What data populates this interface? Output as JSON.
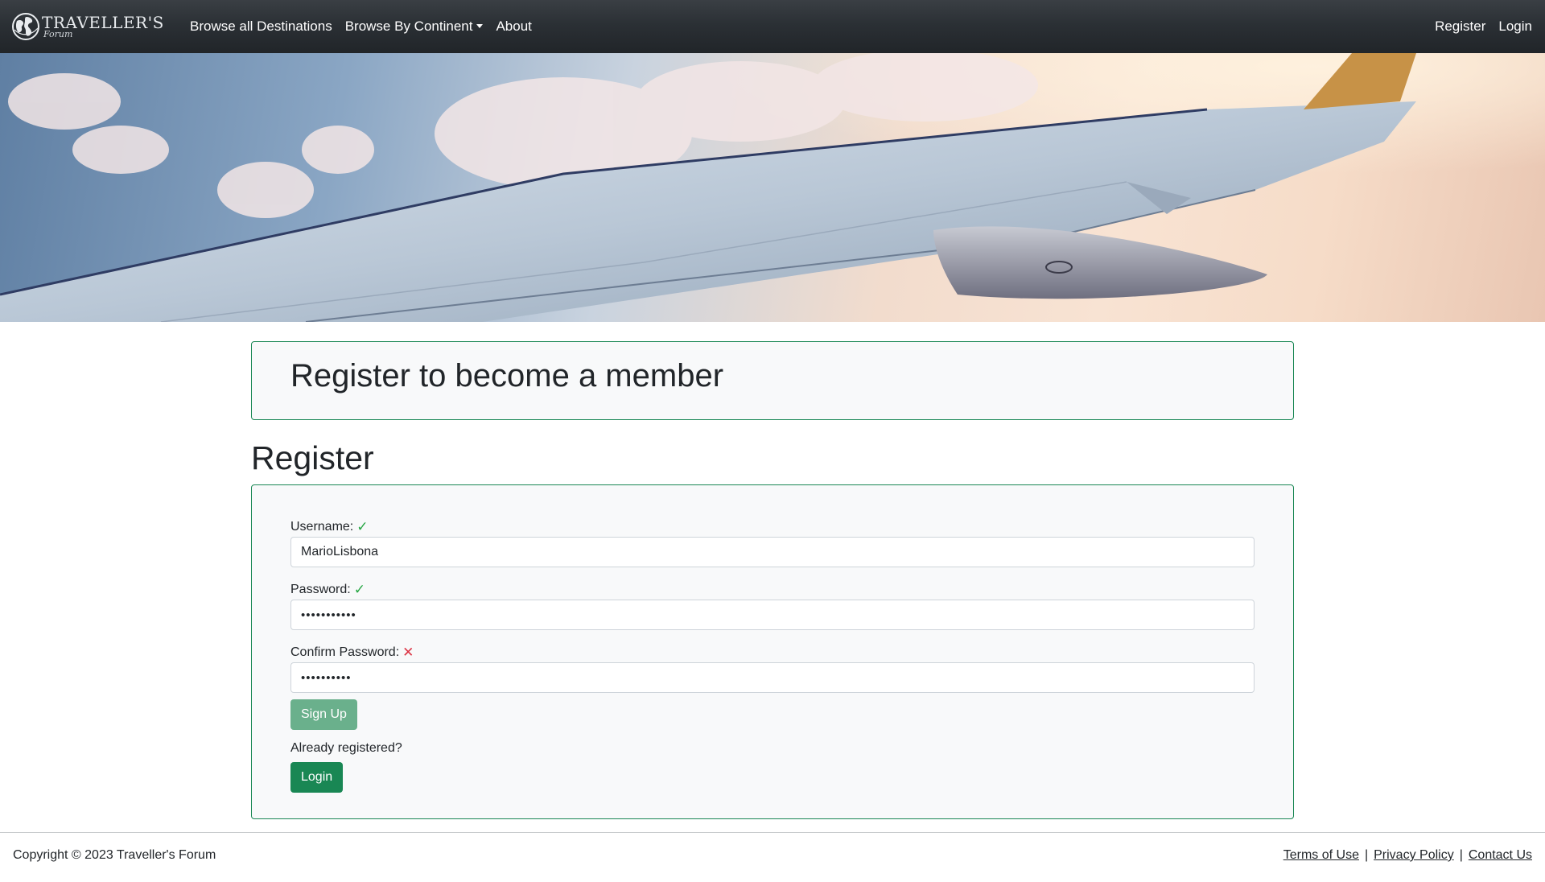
{
  "navbar": {
    "brand_title": "TRAVELLER'S",
    "brand_sub": "Forum",
    "links": [
      {
        "label": "Browse all Destinations"
      },
      {
        "label": "Browse By Continent"
      },
      {
        "label": "About"
      }
    ],
    "right_links": [
      {
        "label": "Register"
      },
      {
        "label": "Login"
      }
    ]
  },
  "header": {
    "title": "Register to become a member"
  },
  "form": {
    "section_title": "Register",
    "username": {
      "label": "Username:",
      "status": "valid",
      "value": "MarioLisbona"
    },
    "password": {
      "label": "Password:",
      "status": "valid",
      "value": "•••••••••••"
    },
    "confirm_password": {
      "label": "Confirm Password:",
      "status": "invalid",
      "value": "••••••••••"
    },
    "signup_label": "Sign Up",
    "already_text": "Already registered?",
    "login_label": "Login"
  },
  "footer": {
    "copyright": "Copyright © 2023 Traveller's Forum",
    "links": [
      {
        "label": "Terms of Use"
      },
      {
        "label": "Privacy Policy"
      },
      {
        "label": "Contact Us"
      }
    ]
  },
  "colors": {
    "navbar": "#212529",
    "accent_green": "#198754",
    "valid": "#28a745",
    "invalid": "#dc3545"
  },
  "icons": {
    "brand": "globe-icon",
    "dropdown": "caret-down-icon",
    "valid": "check-icon",
    "invalid": "x-icon"
  }
}
